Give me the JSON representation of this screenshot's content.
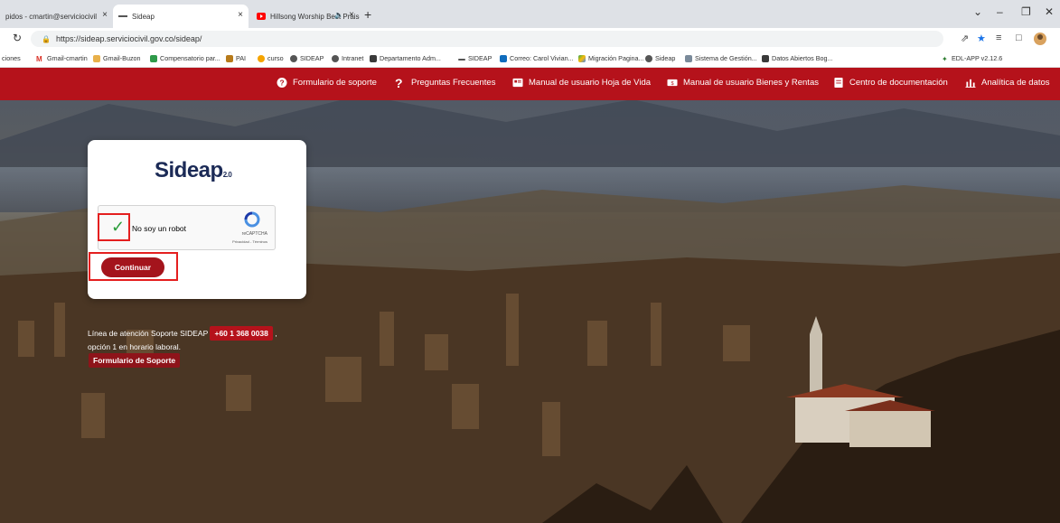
{
  "browser": {
    "tabs": [
      {
        "label": "pidos - cmartin@serviciocivil",
        "close": "×"
      },
      {
        "label": "Sideap",
        "close": "×"
      },
      {
        "label": "Hillsong Worship Best Praise",
        "close": "×"
      }
    ],
    "new_tab": "+",
    "url": "https://sideap.serviciocivil.gov.co/sideap/",
    "bookmarks": [
      "ciones",
      "Gmail-cmartin",
      "Gmail-Buzon",
      "Compensatorio par...",
      "PAI",
      "curso",
      "SIDEAP",
      "Intranet",
      "Departamento Adm...",
      "SIDEAP",
      "Correo: Carol Vivian...",
      "Migración Pagina...",
      "Sideap",
      "Sistema de Gestión...",
      "Datos Abiertos Bog...",
      "EDL-APP v2.12.6"
    ]
  },
  "site": {
    "nav": [
      "Formulario de soporte",
      "Preguntas Frecuentes",
      "Manual de usuario Hoja de Vida",
      "Manual de usuario Bienes y Rentas",
      "Centro de documentación",
      "Analítica de datos"
    ],
    "logo": "Sideap",
    "logo_suffix": "2.0",
    "captcha": {
      "label": "No soy un robot",
      "brand": "reCAPTCHA",
      "links": "Privacidad - Términos"
    },
    "continue_label": "Continuar",
    "support_line": "Línea de atención Soporte SIDEAP",
    "phone": "+60 1 368 0038",
    "support_line2": "opción 1 en horario laboral.",
    "support_form": "Formulario de Soporte"
  },
  "colors": {
    "nav_red": "#b5121b",
    "button_red": "#a4141c",
    "highlight_red": "#e41f1f"
  }
}
